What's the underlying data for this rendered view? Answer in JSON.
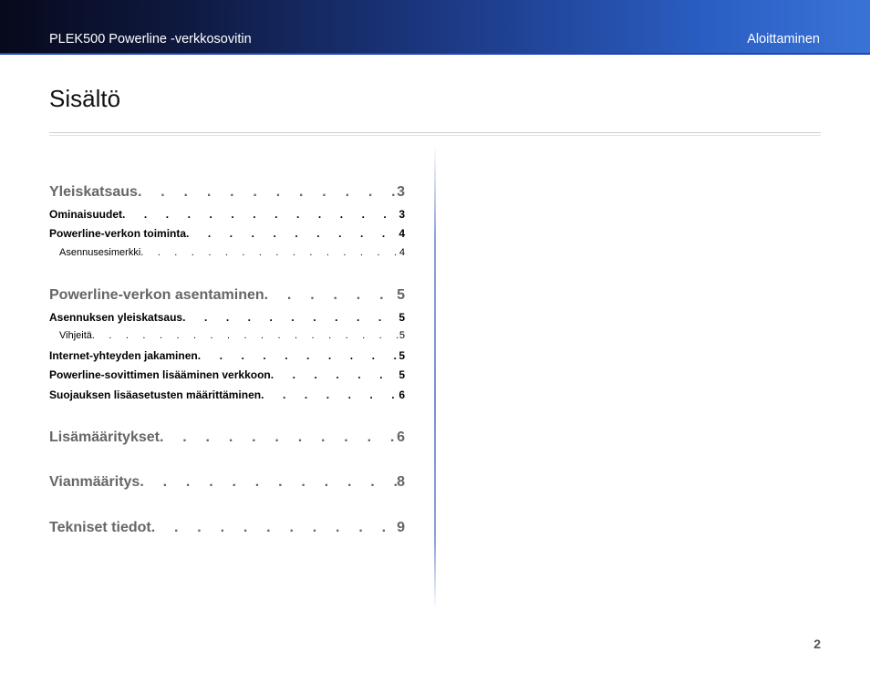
{
  "header": {
    "title": "PLEK500 Powerline -verkkosovitin",
    "section": "Aloittaminen"
  },
  "heading": "Sisältö",
  "toc": [
    {
      "level": 1,
      "title": "Yleiskatsaus",
      "page": "3"
    },
    {
      "level": 2,
      "title": "Ominaisuudet",
      "page": "3"
    },
    {
      "level": 2,
      "title": "Powerline-verkon toiminta",
      "page": "4"
    },
    {
      "level": 3,
      "title": "Asennusesimerkki",
      "page": "4"
    },
    {
      "level": 1,
      "title": "Powerline-verkon asentaminen",
      "page": "5"
    },
    {
      "level": 2,
      "title": "Asennuksen yleiskatsaus",
      "page": "5"
    },
    {
      "level": 3,
      "title": "Vihjeitä",
      "page": "5"
    },
    {
      "level": 2,
      "title": "Internet-yhteyden jakaminen",
      "page": "5"
    },
    {
      "level": 2,
      "title": "Powerline-sovittimen lisääminen verkkoon",
      "page": "5"
    },
    {
      "level": 2,
      "title": "Suojauksen lisäasetusten määrittäminen",
      "page": "6"
    },
    {
      "level": 1,
      "title": "Lisämääritykset",
      "page": "6"
    },
    {
      "level": 1,
      "title": "Vianmääritys",
      "page": "8"
    },
    {
      "level": 1,
      "title": "Tekniset tiedot",
      "page": "9"
    }
  ],
  "page_number": "2"
}
